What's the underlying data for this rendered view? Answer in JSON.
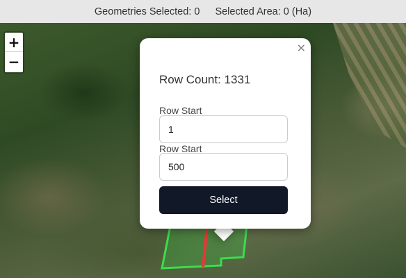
{
  "status_bar": {
    "geometries_selected": "Geometries Selected: 0",
    "selected_area": "Selected Area: 0 (Ha)"
  },
  "zoom_controls": {
    "zoom_in": "+",
    "zoom_out": "−"
  },
  "popup": {
    "close": "×",
    "row_count": "Row Count: 1331",
    "fields": [
      {
        "label": "Row Start",
        "value": "1"
      },
      {
        "label": "Row Start",
        "value": "500"
      }
    ],
    "select_button": "Select"
  },
  "colors": {
    "parcel_outline": "#3ddc4c",
    "selected_row": "#e53935",
    "button_bg": "#111827"
  }
}
